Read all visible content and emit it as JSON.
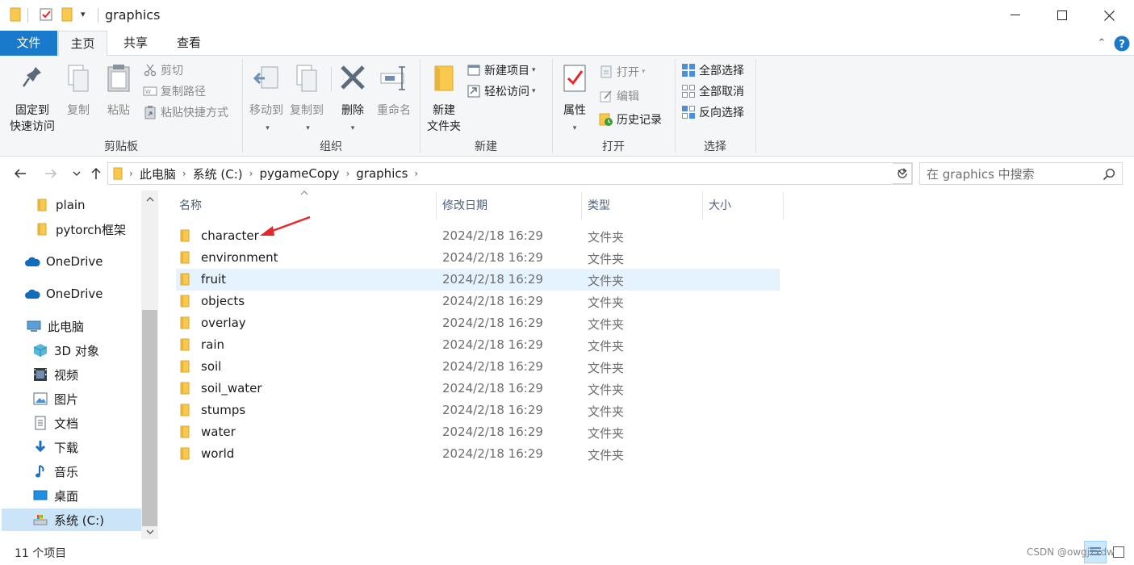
{
  "window": {
    "title": "graphics",
    "minimize_icon": "minimize-icon",
    "maximize_icon": "maximize-icon",
    "close_icon": "close-icon"
  },
  "tabs": [
    {
      "label": "文件"
    },
    {
      "label": "主页"
    },
    {
      "label": "共享"
    },
    {
      "label": "查看"
    }
  ],
  "ribbon": {
    "clipboard": {
      "group_label": "剪贴板",
      "pin_label_1": "固定到",
      "pin_label_2": "快速访问",
      "copy_label": "复制",
      "paste_label": "粘贴",
      "cut_label": "剪切",
      "copy_path_label": "复制路径",
      "paste_shortcut_label": "粘贴快捷方式"
    },
    "organize": {
      "group_label": "组织",
      "move_to_label": "移动到",
      "copy_to_label": "复制到",
      "delete_label": "删除",
      "rename_label": "重命名"
    },
    "new": {
      "group_label": "新建",
      "new_folder_label_1": "新建",
      "new_folder_label_2": "文件夹",
      "new_item_label": "新建项目",
      "easy_access_label": "轻松访问"
    },
    "open": {
      "group_label": "打开",
      "properties_label": "属性",
      "open_label": "打开",
      "edit_label": "编辑",
      "history_label": "历史记录"
    },
    "select": {
      "group_label": "选择",
      "select_all_label": "全部选择",
      "select_none_label": "全部取消",
      "invert_label": "反向选择"
    }
  },
  "address": {
    "breadcrumbs": [
      "此电脑",
      "系统 (C:)",
      "pygameCopy",
      "graphics"
    ],
    "search_placeholder": "在 graphics 中搜索"
  },
  "nav_pane": {
    "items": [
      {
        "label": "plain",
        "icon": "folder-icon"
      },
      {
        "label": "pytorch框架",
        "icon": "folder-icon"
      },
      {
        "label": "OneDrive",
        "icon": "onedrive-cloud-icon"
      },
      {
        "label": "OneDrive",
        "icon": "onedrive-cloud-icon"
      },
      {
        "label": "此电脑",
        "icon": "computer-icon"
      },
      {
        "label": "3D 对象",
        "icon": "3d-objects-icon"
      },
      {
        "label": "视频",
        "icon": "videos-icon"
      },
      {
        "label": "图片",
        "icon": "pictures-icon"
      },
      {
        "label": "文档",
        "icon": "documents-icon"
      },
      {
        "label": "下载",
        "icon": "downloads-icon"
      },
      {
        "label": "音乐",
        "icon": "music-icon"
      },
      {
        "label": "桌面",
        "icon": "desktop-icon"
      },
      {
        "label": "系统 (C:)",
        "icon": "drive-icon"
      }
    ],
    "selected_index": 12
  },
  "file_list": {
    "columns": [
      "名称",
      "修改日期",
      "类型",
      "大小"
    ],
    "rows": [
      {
        "name": "character",
        "date": "2024/2/18 16:29",
        "type": "文件夹"
      },
      {
        "name": "environment",
        "date": "2024/2/18 16:29",
        "type": "文件夹"
      },
      {
        "name": "fruit",
        "date": "2024/2/18 16:29",
        "type": "文件夹"
      },
      {
        "name": "objects",
        "date": "2024/2/18 16:29",
        "type": "文件夹"
      },
      {
        "name": "overlay",
        "date": "2024/2/18 16:29",
        "type": "文件夹"
      },
      {
        "name": "rain",
        "date": "2024/2/18 16:29",
        "type": "文件夹"
      },
      {
        "name": "soil",
        "date": "2024/2/18 16:29",
        "type": "文件夹"
      },
      {
        "name": "soil_water",
        "date": "2024/2/18 16:29",
        "type": "文件夹"
      },
      {
        "name": "stumps",
        "date": "2024/2/18 16:29",
        "type": "文件夹"
      },
      {
        "name": "water",
        "date": "2024/2/18 16:29",
        "type": "文件夹"
      },
      {
        "name": "world",
        "date": "2024/2/18 16:29",
        "type": "文件夹"
      }
    ],
    "hover_row_index": 2
  },
  "status": {
    "item_count": "11 个项目",
    "watermark": "CSDN @owgjzxdw"
  },
  "colors": {
    "file_tab": "#1979ca",
    "folder_yellow": "#f8c94c",
    "selection": "#cce4f7",
    "hover": "#e5f3ff",
    "annotation_arrow": "#e8262d"
  }
}
